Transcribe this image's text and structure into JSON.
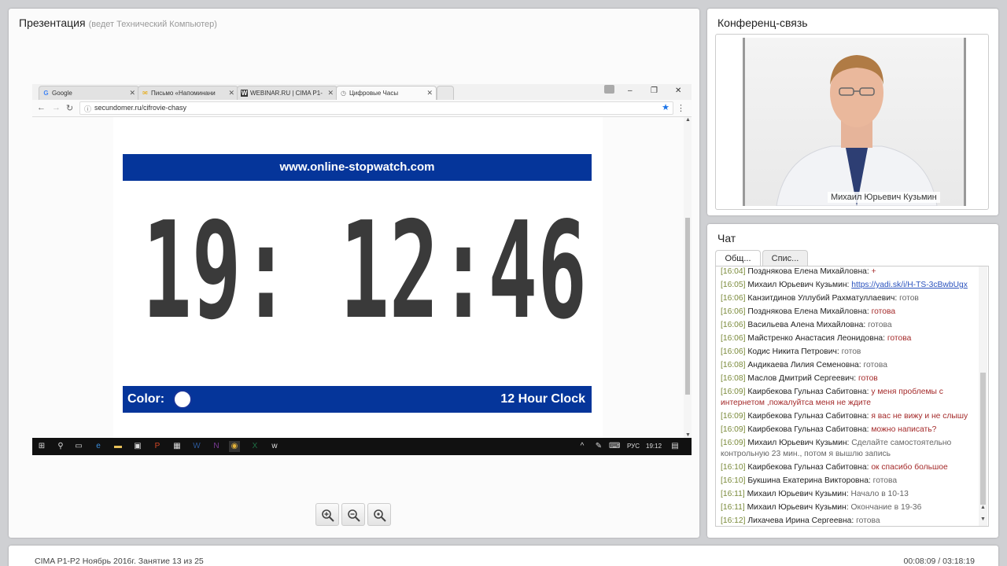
{
  "presentation": {
    "title": "Презентация",
    "subtitle": "(ведет Технический Компьютер)"
  },
  "browser": {
    "tabs": [
      {
        "label": "Google",
        "icon": "google-icon"
      },
      {
        "label": "Письмо «Напоминани",
        "icon": "mail-icon"
      },
      {
        "label": "WEBINAR.RU | CIMA P1-",
        "icon": "webinar-icon"
      },
      {
        "label": "Цифровые Часы",
        "icon": "clock-icon"
      }
    ],
    "url": "secundomer.ru/cifrovie-chasy",
    "site_banner": "www.online-stopwatch.com",
    "clock_time": "19: 12:46",
    "color_label": "Color:",
    "clock_mode": "12 Hour Clock",
    "taskbar": {
      "lang": "РУС",
      "time": "19:12"
    }
  },
  "conference": {
    "title": "Конференц-связь",
    "speaker": "Михаил Юрьевич Кузьмин"
  },
  "chat": {
    "title": "Чат",
    "tabs": [
      "Общ...",
      "Спис..."
    ],
    "messages": [
      {
        "time": "[16:04]",
        "user": "Позднякова Елена Михайловна:",
        "text": "+",
        "style": "accent"
      },
      {
        "time": "[16:05]",
        "user": "Михаил Юрьевич Кузьмин:",
        "text": "https://yadi.sk/i/H-TS-3cBwbUgx",
        "style": "link"
      },
      {
        "time": "[16:06]",
        "user": "Канзитдинов Уллубий Рахматуллаевич:",
        "text": "готов",
        "style": "normal"
      },
      {
        "time": "[16:06]",
        "user": "Позднякова Елена Михайловна:",
        "text": "готова",
        "style": "accent"
      },
      {
        "time": "[16:06]",
        "user": "Васильева Алена Михайловна:",
        "text": "готова",
        "style": "normal"
      },
      {
        "time": "[16:06]",
        "user": "Майстренко Анастасия Леонидовна:",
        "text": "готова",
        "style": "accent"
      },
      {
        "time": "[16:06]",
        "user": "Кодис Никита Петрович:",
        "text": "готов",
        "style": "normal"
      },
      {
        "time": "[16:08]",
        "user": "Андикаева Лилия Семеновна:",
        "text": "готова",
        "style": "normal"
      },
      {
        "time": "[16:08]",
        "user": "Маслов Дмитрий Сергеевич:",
        "text": "готов",
        "style": "accent"
      },
      {
        "time": "[16:09]",
        "user": "Каирбекова Гульназ Сабитовна:",
        "text": "у меня проблемы с интернетом ,пожалуйтса меня не ждите",
        "style": "accent"
      },
      {
        "time": "[16:09]",
        "user": "Каирбекова Гульназ Сабитовна:",
        "text": "я вас не вижу и не слышу",
        "style": "accent"
      },
      {
        "time": "[16:09]",
        "user": "Каирбекова Гульназ Сабитовна:",
        "text": "можно написать?",
        "style": "accent"
      },
      {
        "time": "[16:09]",
        "user": "Михаил Юрьевич Кузьмин:",
        "text": "Сделайте самостоятельно контрольную 23 мин., потом я вышлю запись",
        "style": "normal"
      },
      {
        "time": "[16:10]",
        "user": "Каирбекова Гульназ Сабитовна:",
        "text": "ок спасибо большое",
        "style": "accent"
      },
      {
        "time": "[16:10]",
        "user": "Букшина Екатерина Викторовна:",
        "text": "готова",
        "style": "normal"
      },
      {
        "time": "[16:11]",
        "user": "Михаил Юрьевич Кузьмин:",
        "text": "Начало в 10-13",
        "style": "normal"
      },
      {
        "time": "[16:11]",
        "user": "Михаил Юрьевич Кузьмин:",
        "text": "Окончание в 19-36",
        "style": "normal"
      },
      {
        "time": "[16:12]",
        "user": "Лихачева Ирина Сергеевна:",
        "text": "готова",
        "style": "normal"
      }
    ]
  },
  "footer": {
    "left": "CIMA P1-P2 Ноябрь 2016г. Занятие 13 из 25",
    "right": "00:08:09 / 03:18:19"
  },
  "colors": {
    "banner_blue": "#05359a",
    "chat_time": "#7a8a3a",
    "chat_accent": "#a42a2a",
    "link": "#2a52be"
  }
}
